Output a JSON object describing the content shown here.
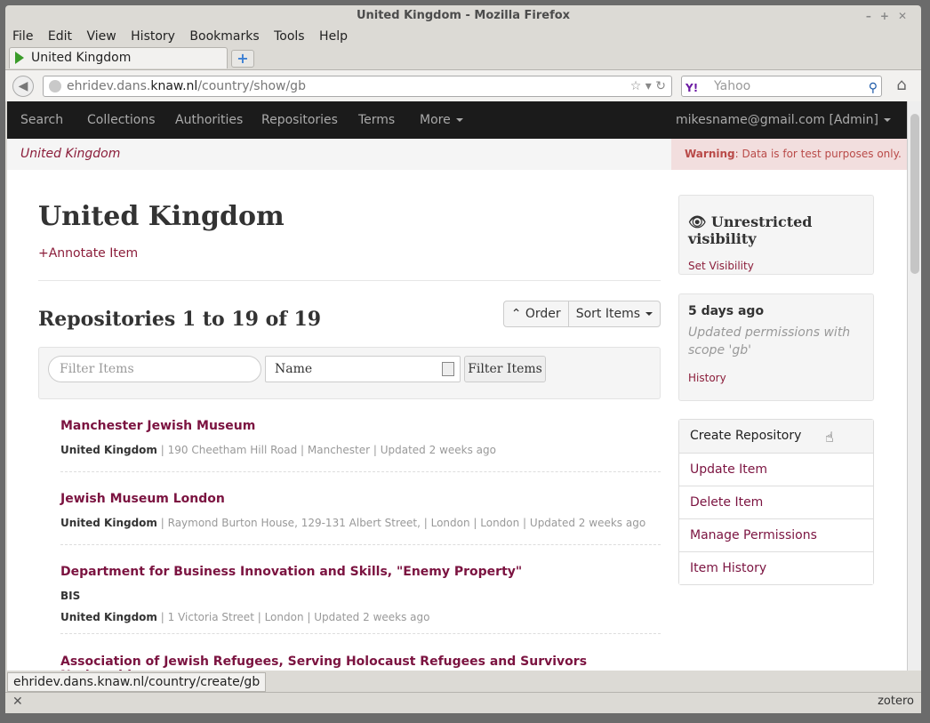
{
  "window": {
    "title": "United Kingdom - Mozilla Firefox"
  },
  "menu": [
    "File",
    "Edit",
    "View",
    "History",
    "Bookmarks",
    "Tools",
    "Help"
  ],
  "tab": {
    "label": "United Kingdom"
  },
  "navbar": {
    "url_prefix": "ehridev.dans.",
    "url_domain": "knaw.nl",
    "url_path": "/country/show/gb",
    "search_placeholder": "Yahoo",
    "search_engine": "Y!"
  },
  "site_nav": {
    "items": [
      "Search",
      "Collections",
      "Authorities",
      "Repositories",
      "Terms",
      "More"
    ],
    "user": "mikesname@gmail.com [Admin]"
  },
  "breadcrumb": "United Kingdom",
  "warning": {
    "label": "Warning",
    "text": ": Data is for test purposes only."
  },
  "main": {
    "title": "United Kingdom",
    "annotate": "+Annotate Item",
    "repositories_heading": "Repositories 1 to 19 of 19",
    "order_label": "Order",
    "sort_label": "Sort Items"
  },
  "filter": {
    "placeholder": "Filter Items",
    "select_value": "Name",
    "button": "Filter Items"
  },
  "items": [
    {
      "title": "Manchester Jewish Museum",
      "meta": [
        [
          "United Kingdom",
          "|  190 Cheetham Hill Road |  Manchester |  Updated 2 weeks ago"
        ]
      ]
    },
    {
      "title": "Jewish Museum London",
      "meta": [
        [
          "United Kingdom",
          "|  Raymond Burton House, 129-131 Albert Street, |  London |  London |  Updated 2 weeks ago"
        ]
      ]
    },
    {
      "title": "Department for Business Innovation and Skills, \"Enemy Property\"",
      "sub": "BIS",
      "meta": [
        [
          "United Kingdom",
          "|  1 Victoria Street |  London |  Updated 2 weeks ago"
        ]
      ]
    },
    {
      "title": "Association of Jewish Refugees, Serving Holocaust Refugees and Survivors Nationwide"
    }
  ],
  "visibility": {
    "heading": "Unrestricted visibility",
    "link": "Set Visibility"
  },
  "history_panel": {
    "when": "5 days ago",
    "what": "Updated permissions with scope 'gb'",
    "link": "History"
  },
  "actions": [
    "Create Repository",
    "Update Item",
    "Delete Item",
    "Manage Permissions",
    "Item History"
  ],
  "status_url": "ehridev.dans.knaw.nl/country/create/gb",
  "addon_bar": {
    "right": "zotero"
  }
}
